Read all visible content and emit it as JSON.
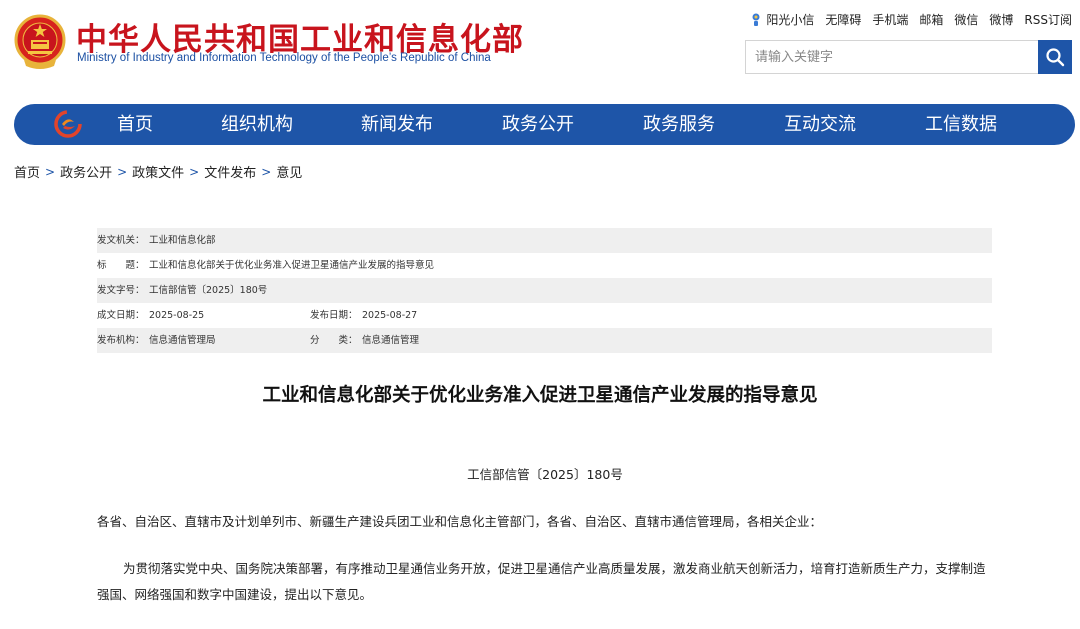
{
  "header": {
    "title": "中华人民共和国工业和信息化部",
    "subtitle": "Ministry of Industry and Information Technology of the People’s Republic of China",
    "top_links": [
      "阳光小信",
      "无障碍",
      "手机端",
      "邮箱",
      "微信",
      "微博",
      "RSS订阅"
    ],
    "search_placeholder": "请输入关键字"
  },
  "nav": {
    "items": [
      "首页",
      "组织机构",
      "新闻发布",
      "政务公开",
      "政务服务",
      "互动交流",
      "工信数据"
    ]
  },
  "breadcrumb": [
    "首页",
    "政务公开",
    "政策文件",
    "文件发布",
    "意见"
  ],
  "breadcrumb_sep": ">",
  "meta": {
    "issuer_label": "发文机关：",
    "issuer": "工业和信息化部",
    "title_label": "标　　题：",
    "title": "工业和信息化部关于优化业务准入促进卫星通信产业发展的指导意见",
    "docno_label": "发文字号：",
    "docno": "工信部信管〔2025〕180号",
    "created_label": "成文日期：",
    "created": "2025-08-25",
    "published_label": "发布日期：",
    "published": "2025-08-27",
    "org_label": "发布机构：",
    "org": "信息通信管理局",
    "category_label": "分　　类：",
    "category": "信息通信管理"
  },
  "document": {
    "title": "工业和信息化部关于优化业务准入促进卫星通信产业发展的指导意见",
    "doc_no": "工信部信管〔2025〕180号",
    "p1": "各省、自治区、直辖市及计划单列市、新疆生产建设兵团工业和信息化主管部门，各省、自治区、直辖市通信管理局，各相关企业：",
    "p2": "为贯彻落实党中央、国务院决策部署，有序推动卫星通信业务开放，促进卫星通信产业高质量发展，激发商业航天创新活力，培育打造新质生产力，支撑制造强国、网络强国和数字中国建设，提出以下意见。"
  },
  "colors": {
    "brand_red": "#c8141d",
    "brand_blue": "#1e55a8",
    "meta_shade": "#efefef"
  }
}
